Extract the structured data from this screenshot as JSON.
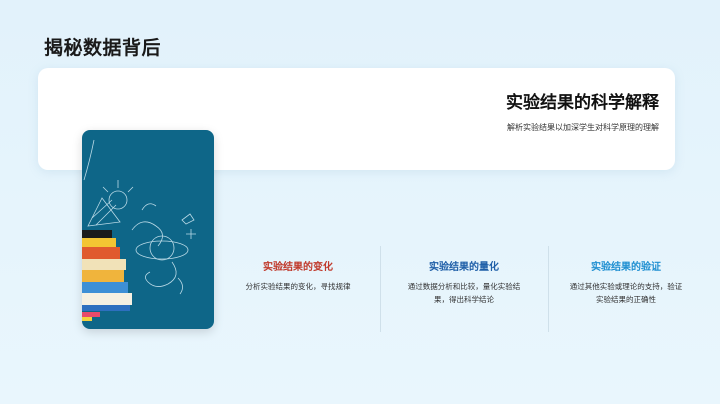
{
  "page": {
    "title": "揭秘数据背后"
  },
  "card": {
    "heading": "实验结果的科学解释",
    "subtitle": "解析实验结果以加深学生对科学原理的理解"
  },
  "image": {
    "icon": "science-books-chalk-illustration"
  },
  "columns": [
    {
      "title": "实验结果的变化",
      "color": "#c0392b",
      "desc": "分析实验结果的变化，寻找规律"
    },
    {
      "title": "实验结果的量化",
      "color": "#1f5fa8",
      "desc": "通过数据分析和比较，量化实验结果，得出科学结论"
    },
    {
      "title": "实验结果的验证",
      "color": "#1f8fd1",
      "desc": "通过其他实验或理论的支持，验证实验结果的正确性"
    }
  ]
}
